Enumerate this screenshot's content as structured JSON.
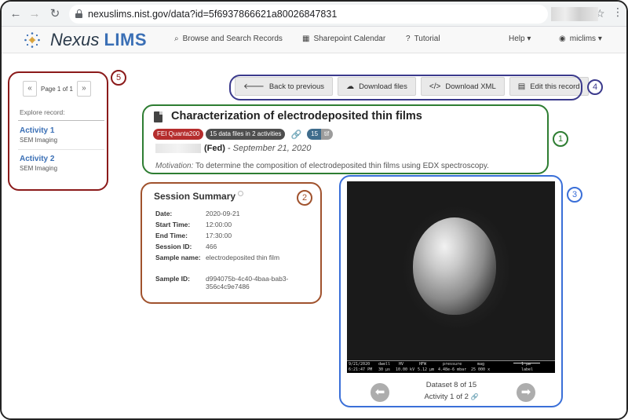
{
  "browser": {
    "url": "nexuslims.nist.gov/data?id=5f6937866621a80026847831"
  },
  "brand": {
    "nexus": "Nexus",
    "lims": "LIMS"
  },
  "navbar": {
    "browse": "Browse and Search Records",
    "calendar": "Sharepoint Calendar",
    "tutorial": "Tutorial",
    "help": "Help",
    "user": "miclims"
  },
  "sidebar": {
    "pager_prev": "«",
    "pager_label": "Page 1 of 1",
    "pager_next": "»",
    "explore_label": "Explore record:",
    "activities": [
      {
        "title": "Activity 1",
        "subtitle": "SEM Imaging"
      },
      {
        "title": "Activity 2",
        "subtitle": "SEM Imaging"
      }
    ]
  },
  "toolbar": {
    "back": "Back to previous",
    "download_files": "Download files",
    "download_xml": "Download XML",
    "edit": "Edit this record"
  },
  "record": {
    "title": "Characterization of electrodeposited thin films",
    "instrument_badge": "FEI Quanta200",
    "files_badge": "15 data files in 2 activities",
    "count_badge": "15",
    "ext_badge": "tif",
    "author_suffix": "(Fed)",
    "date": "September 21, 2020",
    "motivation_label": "Motivation:",
    "motivation_text": "To determine the composition of electrodeposited thin films using EDX spectroscopy."
  },
  "summary": {
    "title": "Session Summary",
    "rows": [
      {
        "key": "Date:",
        "value": "2020-09-21"
      },
      {
        "key": "Start Time:",
        "value": "12:00:00"
      },
      {
        "key": "End Time:",
        "value": "17:30:00"
      },
      {
        "key": "Session ID:",
        "value": "466"
      },
      {
        "key": "Sample name:",
        "value": "electrodeposited thin film"
      },
      {
        "key": "Sample ID:",
        "value": "d994075b-4c40-4baa-bab3-356c4c9e7486"
      }
    ]
  },
  "viewer": {
    "strip": {
      "date": "9/21/2020",
      "time": "6:21:47 PM",
      "dwell_label": "dwell",
      "dwell": "30 μs",
      "hv_label": "HV",
      "hv": "10.00 kV",
      "hfw_label": "HFW",
      "hfw": "5.12 μm",
      "pressure_label": "pressure",
      "pressure": "4.48e-6 mbar",
      "mag_label": "mag",
      "mag": "25 000 x",
      "scale": "1 μm",
      "label": "label"
    },
    "dataset_text": "Dataset 8 of 15",
    "activity_text": "Activity 1 of 2"
  },
  "callouts": [
    "1",
    "2",
    "3",
    "4",
    "5"
  ],
  "colors": {
    "callout1": "#2e7d32",
    "callout2": "#a0522d",
    "callout3": "#3a6fd8",
    "callout4": "#3b3a8c",
    "callout5": "#8b1a1a",
    "link": "#3a6fb5"
  },
  "icons": [
    "back-arrow-icon",
    "forward-arrow-icon",
    "reload-icon",
    "lock-icon",
    "star-icon",
    "search-icon",
    "calendar-icon",
    "question-icon",
    "user-icon",
    "cloud-download-icon",
    "code-icon",
    "file-icon",
    "link-icon"
  ]
}
